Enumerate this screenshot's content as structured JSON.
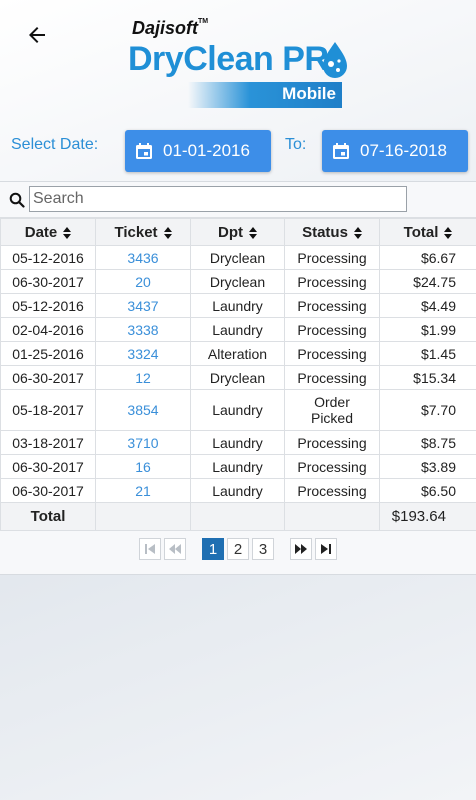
{
  "header": {
    "brand": "Dajisoft",
    "tm": "TM",
    "product": "DryClean PR",
    "edition": "Mobile"
  },
  "filters": {
    "select_date_label": "Select Date:",
    "from_date": "01-01-2016",
    "to_label": "To:",
    "to_date": "07-16-2018"
  },
  "search": {
    "placeholder": "Search"
  },
  "table": {
    "columns": [
      "Date",
      "Ticket",
      "Dpt",
      "Status",
      "Total"
    ],
    "rows": [
      {
        "date": "05-12-2016",
        "ticket": "3436",
        "dpt": "Dryclean",
        "status": "Processing",
        "total": "$6.67"
      },
      {
        "date": "06-30-2017",
        "ticket": "20",
        "dpt": "Dryclean",
        "status": "Processing",
        "total": "$24.75"
      },
      {
        "date": "05-12-2016",
        "ticket": "3437",
        "dpt": "Laundry",
        "status": "Processing",
        "total": "$4.49"
      },
      {
        "date": "02-04-2016",
        "ticket": "3338",
        "dpt": "Laundry",
        "status": "Processing",
        "total": "$1.99"
      },
      {
        "date": "01-25-2016",
        "ticket": "3324",
        "dpt": "Alteration",
        "status": "Processing",
        "total": "$1.45"
      },
      {
        "date": "06-30-2017",
        "ticket": "12",
        "dpt": "Dryclean",
        "status": "Processing",
        "total": "$15.34"
      },
      {
        "date": "05-18-2017",
        "ticket": "3854",
        "dpt": "Laundry",
        "status_line1": "Order",
        "status_line2": "Picked",
        "total": "$7.70"
      },
      {
        "date": "03-18-2017",
        "ticket": "3710",
        "dpt": "Laundry",
        "status": "Processing",
        "total": "$8.75"
      },
      {
        "date": "06-30-2017",
        "ticket": "16",
        "dpt": "Laundry",
        "status": "Processing",
        "total": "$3.89"
      },
      {
        "date": "06-30-2017",
        "ticket": "21",
        "dpt": "Laundry",
        "status": "Processing",
        "total": "$6.50"
      }
    ],
    "footer_label": "Total",
    "footer_total": "$193.64"
  },
  "pagination": {
    "pages": [
      "1",
      "2",
      "3"
    ],
    "current": "1"
  },
  "colors": {
    "accent": "#3d8ee8",
    "link": "#3a8fd9",
    "active_page": "#1f6fb2"
  }
}
